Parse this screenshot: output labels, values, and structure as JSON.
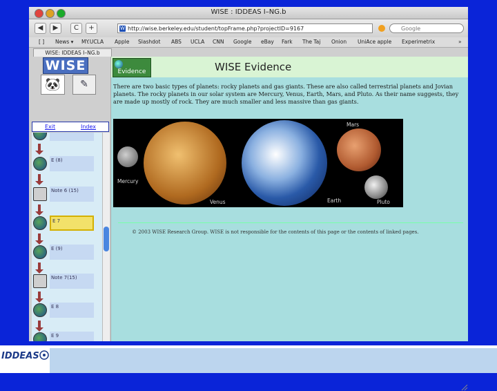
{
  "browser": {
    "window_title": "WISE : IDDEAS I–NG.b",
    "url": "http://wise.berkeley.edu/student/topFrame.php?projectID=9167",
    "search_placeholder": "Google",
    "nav_back": "◀",
    "nav_forward": "▶",
    "nav_reload": "C",
    "nav_add": "+",
    "bookmarks_toggle": "[ ]",
    "bookmarks": [
      "News ▾",
      "MY.UCLA",
      "Apple",
      "Slashdot",
      "ABS",
      "UCLA",
      "CNN",
      "Google",
      "eBay",
      "Fark",
      "The Taj",
      "Onion",
      "UniAce apple",
      "Experimetrix"
    ],
    "bookmarks_more": "»",
    "tab_label": "WISE: IDDEAS I–NG.b"
  },
  "left_frame": {
    "logo": "WISE",
    "exit_link": "Exit",
    "index_link": "Index",
    "steps": [
      {
        "label": "...",
        "type": "globe",
        "active": false
      },
      {
        "label": "E (8)",
        "type": "globe",
        "active": false
      },
      {
        "label": "Note 6 (15)",
        "type": "note",
        "active": false
      },
      {
        "label": "E 7",
        "type": "globe",
        "active": true
      },
      {
        "label": "E (9)",
        "type": "globe",
        "active": false
      },
      {
        "label": "Note 7(15)",
        "type": "note",
        "active": false
      },
      {
        "label": "E 8",
        "type": "globe",
        "active": false
      },
      {
        "label": "E 9",
        "type": "globe",
        "active": false
      }
    ]
  },
  "right_frame": {
    "tab_label": "Evidence",
    "title": "WISE Evidence",
    "body": "There are two basic types of planets: rocky planets and gas giants. These are also called terrestrial planets and Jovian planets. The rocky planets in our solar system are Mercury, Venus, Earth, Mars, and Pluto. As their name suggests, they are made up mostly of rock. They are much smaller and less massive than gas giants.",
    "planet_labels": {
      "mercury": "Mercury",
      "venus": "Venus",
      "earth": "Earth",
      "mars": "Mars",
      "pluto": "Pluto"
    },
    "copyright": "© 2003 WISE Research Group. WISE is not responsible for the contents of this page or the contents of linked pages."
  },
  "footer": {
    "logo_text": "IDDEAS"
  },
  "colors": {
    "slide_background": "#0a24d8",
    "content_background": "#a8dedf",
    "header_background": "#d9f4d4",
    "active_step": "#f2e16a"
  }
}
